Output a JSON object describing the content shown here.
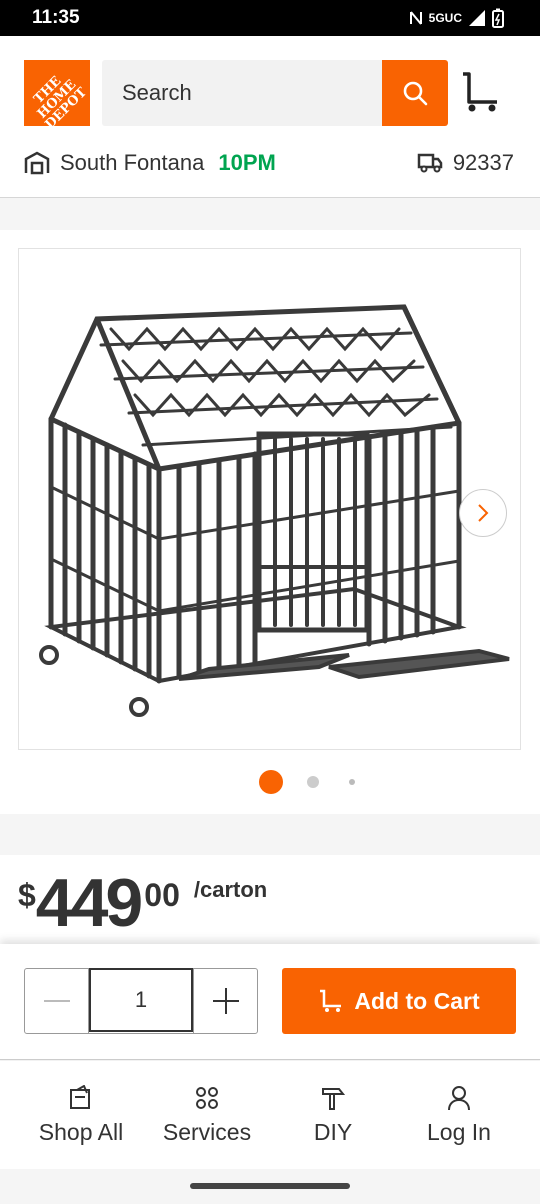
{
  "status_bar": {
    "time": "11:35",
    "network": "5GUC"
  },
  "header": {
    "logo_text": "THE HOME DEPOT",
    "search_placeholder": "Search",
    "store_name": "South Fontana",
    "store_hours": "10PM",
    "zip": "92337"
  },
  "gallery": {
    "image_alt": "Heavy-duty dog crate with peaked roof",
    "image_count": 3,
    "active_index": 0
  },
  "price": {
    "currency": "$",
    "whole": "449",
    "cents": "00",
    "unit": "/carton"
  },
  "purchase": {
    "quantity": "1",
    "add_to_cart_label": "Add to Cart"
  },
  "bottom_nav": {
    "items": [
      {
        "label": "Shop All",
        "icon": "shop-all-icon"
      },
      {
        "label": "Services",
        "icon": "services-icon"
      },
      {
        "label": "DIY",
        "icon": "diy-icon"
      },
      {
        "label": "Log In",
        "icon": "user-icon"
      }
    ]
  },
  "colors": {
    "brand": "#f96302",
    "hours_green": "#00a450"
  }
}
